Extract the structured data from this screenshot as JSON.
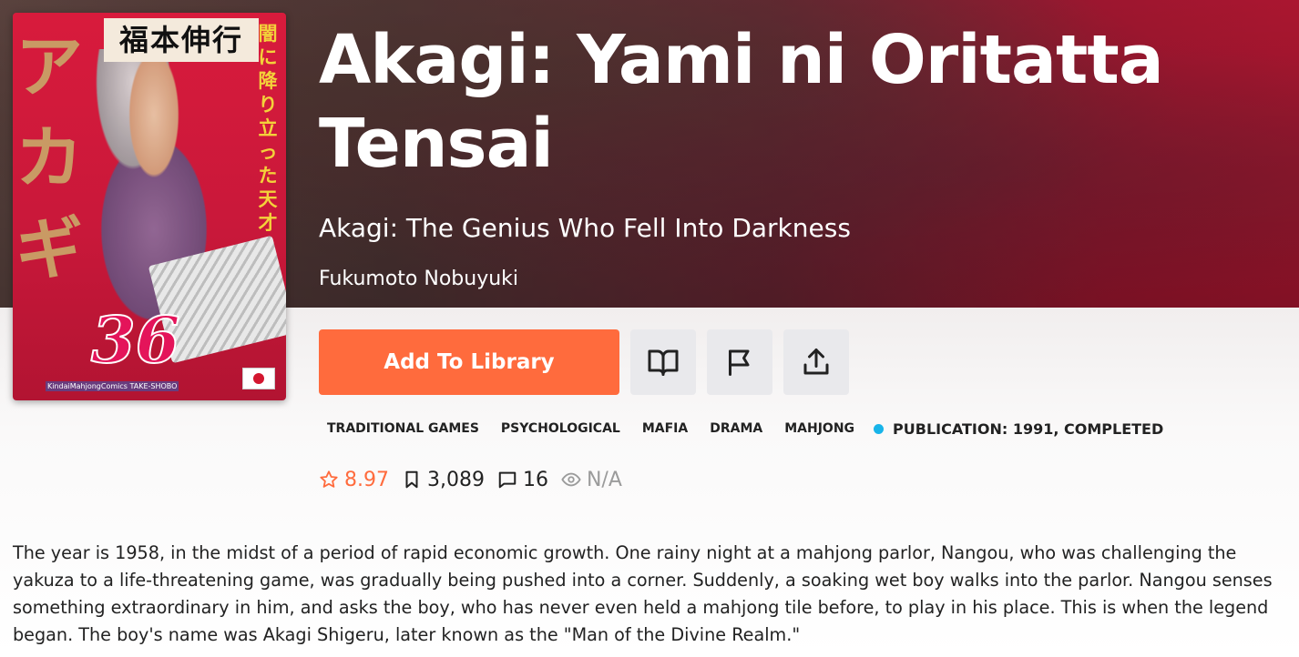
{
  "hero": {
    "title": "Akagi: Yami ni Oritatta Tensai",
    "alt_title": "Akagi: The Genius Who Fell Into Darkness",
    "author": "Fukumoto Nobuyuki"
  },
  "cover": {
    "author_jp": "福本伸行",
    "title_jp": "アカギ",
    "subtitle_jp": "闇に降り立った天才",
    "volume": "36",
    "publisher": "KindaiMahjongComics TAKE-SHOBO",
    "flag_icon": "japan-flag-icon"
  },
  "actions": {
    "add_to_library": "Add To Library",
    "read_icon": "book-open-icon",
    "report_icon": "flag-icon",
    "share_icon": "share-upload-icon",
    "accent_color": "#ff6b3d"
  },
  "tags": [
    "TRADITIONAL GAMES",
    "PSYCHOLOGICAL",
    "MAFIA",
    "DRAMA",
    "MAHJONG"
  ],
  "publication": {
    "label": "PUBLICATION: 1991, COMPLETED",
    "status_color": "#18b4e9"
  },
  "stats": {
    "rating": "8.97",
    "follows": "3,089",
    "comments": "16",
    "views": "N/A"
  },
  "description": "The year is 1958, in the midst of a period of rapid economic growth. One rainy night at a mahjong parlor, Nangou, who was challenging the yakuza to a life-threatening game, was gradually being pushed into a corner. Suddenly, a soaking wet boy walks into the parlor. Nangou senses something extraordinary in him, and asks the boy, who has never even held a mahjong tile before, to play in his place. This is when the legend began. The boy's name was Akagi Shigeru, later known as the \"Man of the Divine Realm.\""
}
